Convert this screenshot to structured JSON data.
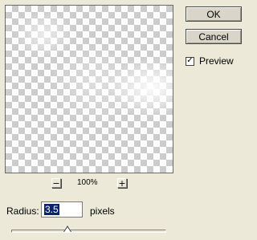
{
  "buttons": {
    "ok_label": "OK",
    "cancel_label": "Cancel"
  },
  "preview_toggle": {
    "label": "Preview",
    "checked": true,
    "check_glyph": "✓"
  },
  "zoom": {
    "out_glyph": "−",
    "in_glyph": "+",
    "level": "100%"
  },
  "radius": {
    "label": "Radius:",
    "value": "3.5",
    "units": "pixels",
    "slider_fraction": 0.36
  }
}
